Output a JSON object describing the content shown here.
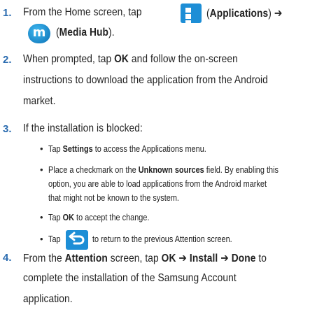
{
  "steps": [
    {
      "number": "1.",
      "line1_prefix": "From the Home screen, tap",
      "line1_apps": "(",
      "line1_apps_bold": "Applications",
      "line1_apps_end": ") ➔",
      "line2_open": "(",
      "line2_bold": "Media Hub",
      "line2_close": ")."
    },
    {
      "number": "2.",
      "line1_pre": "When prompted, tap ",
      "line1_bold": "OK",
      "line1_post": " and follow the on-screen",
      "line2": "instructions to download the application from the Android",
      "line3": "market."
    },
    {
      "number": "3.",
      "line1": "If the installation is blocked:"
    },
    {
      "number": "4.",
      "line1_pre": "From the ",
      "line1_b1": "Attention",
      "line1_mid1": " screen, tap ",
      "line1_b2": "OK",
      "line1_arrow1": " ➔ ",
      "line1_b3": "Install",
      "line1_arrow2": " ➔ ",
      "line1_b4": "Done",
      "line1_post": " to",
      "line2": "complete the installation of the Samsung Account",
      "line3": "application."
    }
  ],
  "sub_bullets": [
    {
      "pre": "Tap ",
      "bold": "Settings",
      "post": " to access the Applications menu."
    },
    {
      "pre": "Place a checkmark on the ",
      "bold": "Unknown sources",
      "post": " field. By enabling this",
      "line2": "option, you are able to load applications from the Android market",
      "line3": "that might not be known to the system."
    },
    {
      "pre": "Tap ",
      "bold": "OK",
      "post": " to accept the change."
    },
    {
      "pre": "Tap",
      "post": "to return to the previous Attention screen."
    }
  ],
  "icons": {
    "applications": "applications-grid-icon",
    "media_hub": "media-hub-icon",
    "back": "back-arrow-icon",
    "media_hub_glyph": "m"
  },
  "colors": {
    "step_number": "#2b6cb0",
    "icon_blue": "#1d8ed6"
  }
}
